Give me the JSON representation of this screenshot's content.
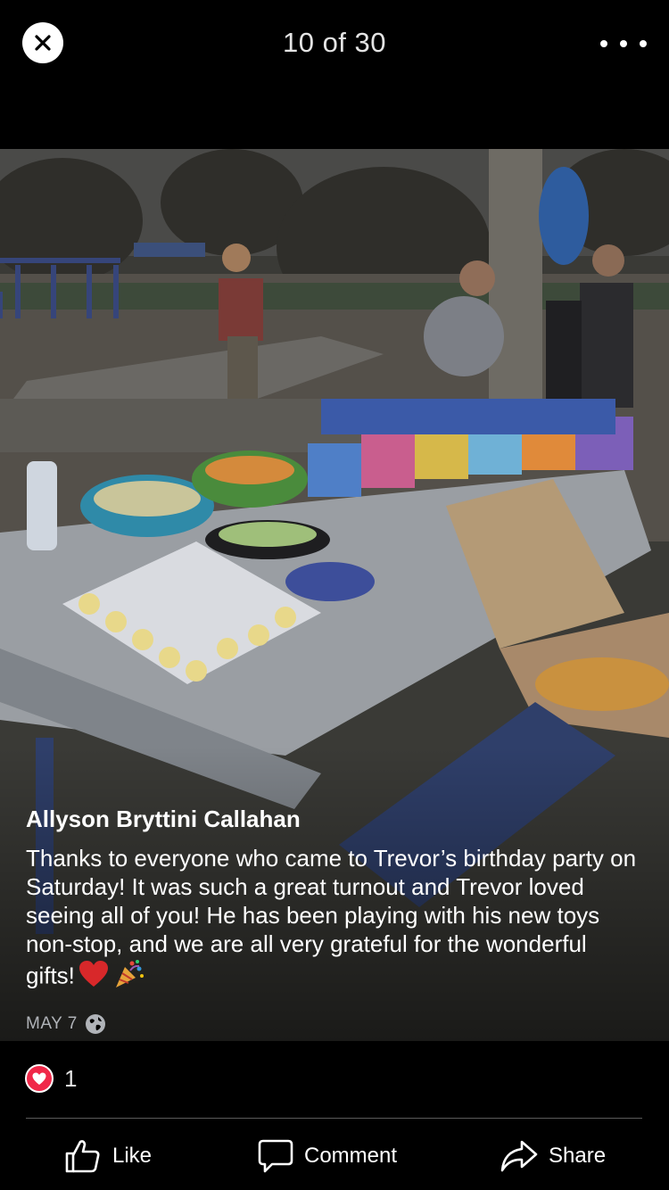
{
  "header": {
    "counter": "10 of 30",
    "close_icon": "close-icon",
    "more_icon": "more-dots-icon"
  },
  "photo": {
    "alt": "birthday party picnic table with cupcakes, snacks and gift boxes in a park"
  },
  "post": {
    "author": "Allyson Bryttini Callahan",
    "text": "Thanks to everyone who came to Trevor’s birthday party on Saturday! It was such a great turnout and Trevor loved seeing all of you! He has been playing with his new toys non-stop, and we are all very grateful for the wonderful gifts!",
    "emojis": [
      "heart-emoji",
      "party-popper-emoji"
    ],
    "date": "MAY 7",
    "privacy_icon": "globe-icon"
  },
  "reactions": {
    "icon": "heart-reaction-icon",
    "count": "1",
    "color": "#f02849"
  },
  "actions": {
    "like_label": "Like",
    "comment_label": "Comment",
    "share_label": "Share"
  }
}
